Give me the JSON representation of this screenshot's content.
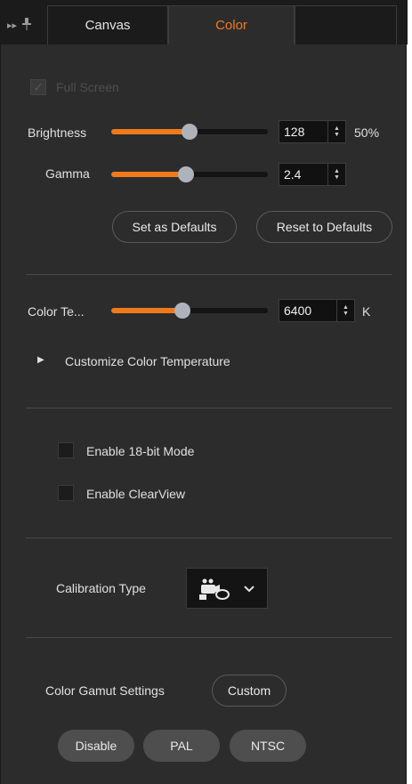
{
  "tabs": {
    "canvas": "Canvas",
    "color": "Color"
  },
  "full_screen": {
    "label": "Full Screen",
    "checked": true,
    "disabled": true
  },
  "brightness": {
    "label": "Brightness",
    "value": "128",
    "percent": "50%",
    "level": 0.5
  },
  "gamma": {
    "label": "Gamma",
    "value": "2.4",
    "level": 0.48
  },
  "defaults": {
    "set_label": "Set as Defaults",
    "reset_label": "Reset to Defaults"
  },
  "color_temp": {
    "label": "Color Te...",
    "value": "6400",
    "unit": "K",
    "level": 0.46
  },
  "customize": {
    "label": "Customize Color Temperature",
    "expanded": false
  },
  "options": {
    "mode18": {
      "label": "Enable 18-bit Mode",
      "checked": false
    },
    "clearview": {
      "label": "Enable ClearView",
      "checked": false
    }
  },
  "calibration": {
    "label": "Calibration Type",
    "icon": "calibration-camera-icon"
  },
  "gamut": {
    "label": "Color Gamut Settings",
    "selected": "Custom",
    "options": [
      "Disable",
      "PAL",
      "NTSC"
    ]
  },
  "colors": {
    "accent": "#ef7a1a",
    "background": "#2c2c2c",
    "header": "#1b1b1b"
  }
}
